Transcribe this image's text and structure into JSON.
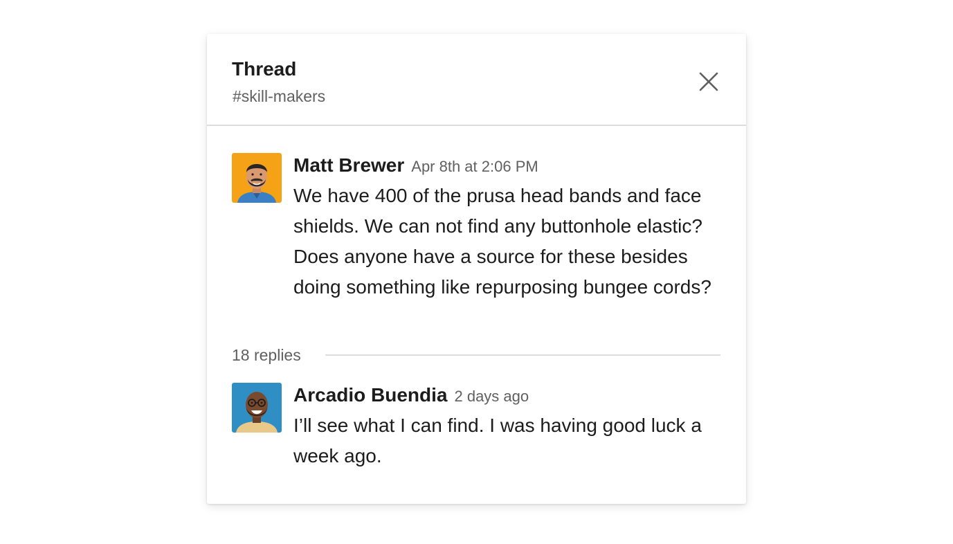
{
  "thread": {
    "title": "Thread",
    "channel": "#skill-makers",
    "close_icon": "close-icon"
  },
  "messages": [
    {
      "author": "Matt Brewer",
      "timestamp": "Apr 8th at 2:06 PM",
      "text": "We have 400 of the prusa head bands and face shields.  We can not find any buttonhole elastic?  Does anyone have a source for these besides doing something like repurposing bungee cords?",
      "avatar_bg": "#f5a216"
    }
  ],
  "replies": {
    "count_label": "18 replies"
  },
  "reply_messages": [
    {
      "author": "Arcadio Buendia",
      "timestamp": "2 days ago",
      "text": "I’ll see what I can find. I was having good luck a week ago.",
      "avatar_bg": "#2f8fc4"
    }
  ],
  "colors": {
    "text_primary": "#1d1c1d",
    "text_secondary": "#616061",
    "divider": "#dddddd"
  }
}
